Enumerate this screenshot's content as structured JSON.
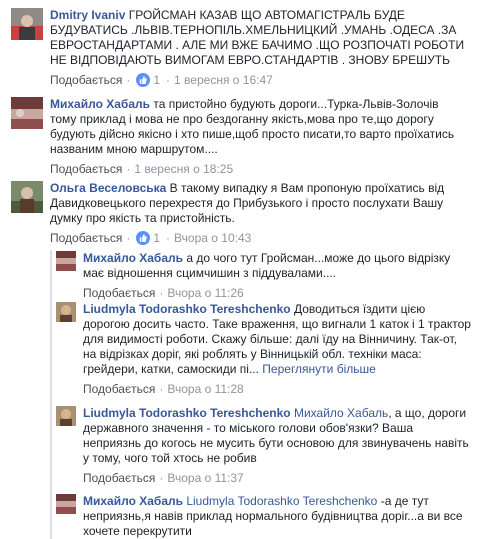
{
  "comments": [
    {
      "author": "Dmitry Ivaniv",
      "text": " ГРОЙСМАН КАЗАВ ЩО АВТОМАГІСТРАЛЬ БУДЕ БУДУВАТИСЬ .ЛЬВІВ.ТЕРНОПІЛЬ.ХМЕЛЬНИЦКИЙ .УМАНЬ .ОДЕСА .ЗА ЕВРОСТАНДАРТАМИ . АЛЕ МИ ВЖЕ БАЧИМО .ЩО РОЗПОЧАТІ РОБОТИ НЕ ВІДПОВІДАЮТЬ ВИМОГАМ ЕВРО.СТАНДАРТІВ . ЗНОВУ БРЕШУТЬ",
      "like_label": "Подобається",
      "like_count": "1",
      "time": "1 вересня о 16:47"
    },
    {
      "author": "Михайло Хабаль",
      "text": " та пристойно будують дороги...Турка-Львів-Золочів тому приклад і мова не про бездоганну якість,мова про те,що дорогу будують дійсно якісно і хто пише,щоб просто писати,то варто проїхатись названим мною маршрутом....",
      "like_label": "Подобається",
      "time": "1 вересня о 18:25"
    },
    {
      "author": "Ольга Веселовська",
      "text": " В такому випадку я Вам пропоную проїхатись від Давидковецького перехрестя до Прибузького і просто послухати Вашу думку про якість та пристойність.",
      "like_label": "Подобається",
      "like_count": "1",
      "time": "Вчора о 10:43"
    }
  ],
  "replies": [
    {
      "author": "Михайло Хабаль",
      "text": " а до чого тут Гройсман...може до цього відрізку має відношення сцимчишин з піддувалами....",
      "like_label": "Подобається",
      "time": "Вчора о 11:26"
    },
    {
      "author": "Liudmyla Todorashko Tereshchenko",
      "text": " Доводиться їздити цією дорогою досить часто. Таке враження, що вигнали 1 каток і 1 трактор для видимості роботи. Скажу більше: далі їду на Вінничину. Так-от, на відрізках доріг, які роблять у Вінницькій обл. техніки маса: грейдери, катки, самоскиди пі...",
      "see_more": "Переглянути більше",
      "like_label": "Подобається",
      "time": "Вчора о 11:28"
    },
    {
      "author": "Liudmyla Todorashko Tereshchenko",
      "mention": "Михайло Хабаль",
      "text": ", а що, дороги державного значення - то міського голови обов'язки? Ваша неприязнь до когось не мусить бути основою для звинувачень навіть у тому, чого той хтось не робив",
      "like_label": "Подобається",
      "time": "Вчора о 11:37"
    },
    {
      "author": "Михайло Хабаль",
      "mention": "Liudmyla Todorashko Tereshchenko",
      "text": " -а де тут неприязнь,я навів приклад нормального будівництва доріг...а ви все хочете перекрутити"
    }
  ],
  "colors": {
    "link": "#385898",
    "meta": "#90949c",
    "like_badge": "#5890ff"
  }
}
